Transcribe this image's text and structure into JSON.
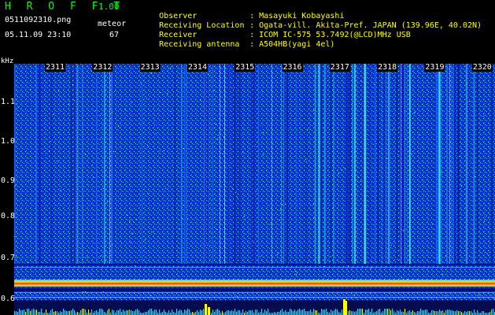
{
  "header": {
    "brand": "H R O F F T",
    "version": "1.00",
    "filename": "0511092310.png",
    "datetime": "05.11.09 23:10",
    "meteor_label": "meteor",
    "meteor_count": "67"
  },
  "info": [
    {
      "label": "Observer",
      "value": "Masayuki Kobayashi"
    },
    {
      "label": "Receiving Location",
      "value": "Ogata-vill. Akita-Pref. JAPAN (139.96E, 40.02N)"
    },
    {
      "label": "Receiver",
      "value": "ICOM IC-575 53.7492(@LCD)MHz USB"
    },
    {
      "label": "Receiving antenna",
      "value": "A504HB(yagi 4el)"
    }
  ],
  "separator": ":",
  "axis": {
    "y_unit": "kHz",
    "y_ticks": [
      "1.1",
      "1.0",
      "0.9",
      "0.8",
      "0.7",
      "0.6"
    ],
    "x_ticks": [
      "2311",
      "2312",
      "2313",
      "2314",
      "2315",
      "2316",
      "2317",
      "2318",
      "2319",
      "2320"
    ]
  },
  "colors": {
    "brand": "#00ff00",
    "info": "#ffff00",
    "background": "#000000",
    "spectrum_base": "#0a2bd0",
    "meteor_trace": "#ff2020",
    "ticks": "#ffffff"
  }
}
